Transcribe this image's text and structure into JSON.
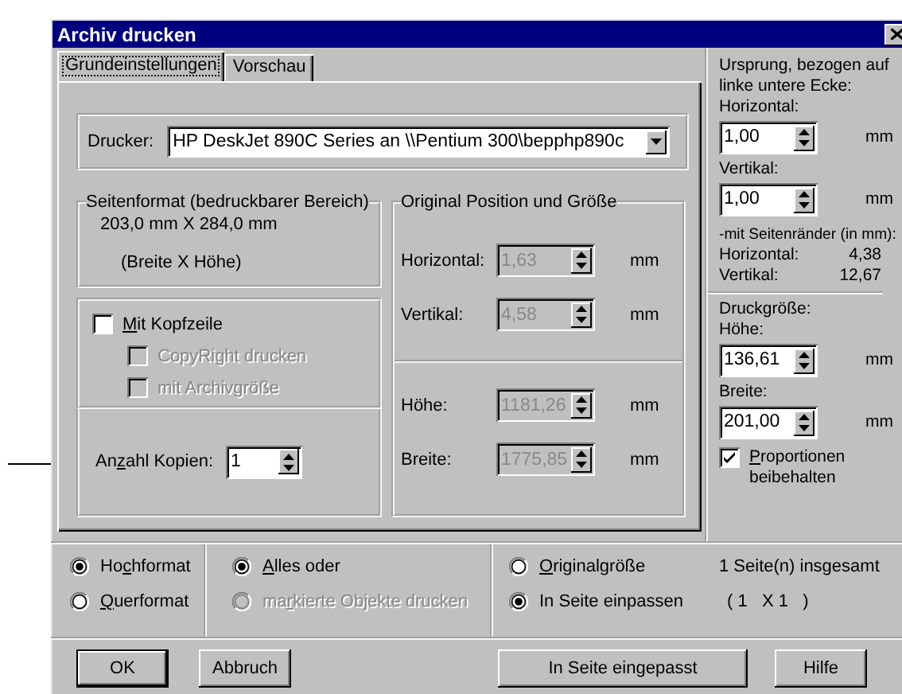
{
  "window": {
    "title": "Archiv drucken"
  },
  "tabs": [
    {
      "label": "Grundeinstellungen",
      "selected": true
    },
    {
      "label": "Vorschau",
      "selected": false
    }
  ],
  "printer": {
    "label": "Drucker:",
    "value": "HP DeskJet 890C Series an \\\\Pentium 300\\bepphp890c"
  },
  "page_format": {
    "title": "Seitenformat (bedruckbarer Bereich)",
    "size": "203,0 mm X 284,0 mm",
    "note": "(Breite X Höhe)"
  },
  "header": {
    "label": {
      "key": "M",
      "post": "it Kopfzeile"
    },
    "checked": false,
    "disabled": false,
    "options": [
      {
        "label": {
          "pre": "CopyRight drucken"
        },
        "checked": false,
        "disabled": true
      },
      {
        "label": {
          "pre": "mit Archivgröße"
        },
        "checked": false,
        "disabled": true
      }
    ]
  },
  "copies": {
    "label": {
      "pre": "An",
      "key": "z",
      "post": "ahl Kopien:"
    },
    "value": "1",
    "disabled": false
  },
  "original": {
    "title": "Original Position und Größe",
    "position_fields": [
      {
        "label": "Horizontal:",
        "value": "1,63",
        "unit": "mm",
        "disabled": true
      },
      {
        "label": "Vertikal:",
        "value": "4,58",
        "unit": "mm",
        "disabled": true
      }
    ],
    "size_fields": [
      {
        "label": "Höhe:",
        "value": "1181,26",
        "unit": "mm",
        "disabled": true
      },
      {
        "label": "Breite:",
        "value": "1775,85",
        "unit": "mm",
        "disabled": true
      }
    ]
  },
  "origin": {
    "lines": [
      "Ursprung, bezogen auf",
      "linke untere Ecke:"
    ],
    "fields": [
      {
        "label": "Horizontal:",
        "value": "1,00",
        "unit": "mm",
        "disabled": false
      },
      {
        "label": "Vertikal:",
        "value": "1,00",
        "unit": "mm",
        "disabled": false
      }
    ]
  },
  "margins": {
    "title": "-mit Seitenränder (in mm):",
    "rows": [
      {
        "label": "Horizontal:",
        "value": "4,38"
      },
      {
        "label": "Vertikal:",
        "value": "12,67"
      }
    ]
  },
  "print_size": {
    "title": "Druckgröße:",
    "fields": [
      {
        "label": "Höhe:",
        "value": "136,61",
        "unit": "mm",
        "disabled": false
      },
      {
        "label": "Breite:",
        "value": "201,00",
        "unit": "mm",
        "disabled": false
      }
    ],
    "keep_proportions": {
      "label": {
        "key": "P",
        "post": "roportionen beibehalten"
      },
      "checked": true,
      "disabled": false
    }
  },
  "orientation": [
    {
      "label": {
        "pre": "Ho",
        "key": "c",
        "post": "hformat"
      },
      "selected": true,
      "disabled": false
    },
    {
      "label": {
        "key": "Q",
        "post": "uerformat"
      },
      "selected": false,
      "disabled": false
    }
  ],
  "scope": [
    {
      "label": {
        "key": "A",
        "post": "lles oder"
      },
      "selected": true,
      "disabled": false
    },
    {
      "label": {
        "pre": "ma",
        "key": "r",
        "post": "kierte Objekte drucken"
      },
      "selected": false,
      "disabled": true
    }
  ],
  "scaling": [
    {
      "label": {
        "key": "O",
        "post": "riginalgröße"
      },
      "selected": false,
      "disabled": false
    },
    {
      "label": {
        "pre": "In Seite einpassen"
      },
      "selected": true,
      "disabled": false
    }
  ],
  "pages": {
    "total": "1 Seite(n) insgesamt",
    "grid": "( 1   X 1   )"
  },
  "buttons": [
    {
      "label": "OK",
      "default": true
    },
    {
      "label": "Abbruch",
      "default": false
    },
    {
      "label": "In Seite eingepasst",
      "default": false
    },
    {
      "label": "Hilfe",
      "default": false
    }
  ]
}
